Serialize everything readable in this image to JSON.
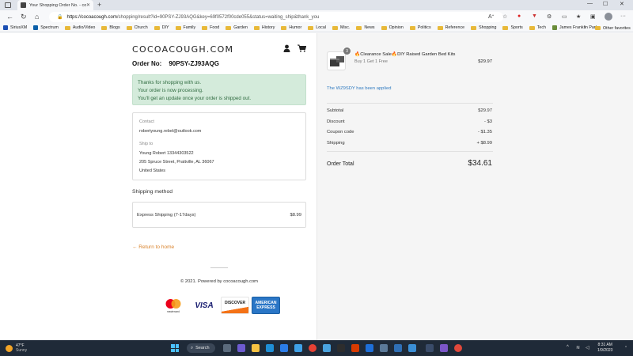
{
  "browser": {
    "tab_title": "Your Shopping Order No. - coco",
    "url_host": "https://cocoacough.com",
    "url_path": "/shopping/result?id=90PSY-ZJ93AQG&key=69f0572f00cde055&status=waiting_ship&thank_you",
    "bookmarks": [
      "SiriusXM",
      "Spectrum",
      "Audio/Video",
      "Blogs",
      "Church",
      "DIY",
      "Family",
      "Food",
      "Garden",
      "History",
      "Humor",
      "Local",
      "Misc.",
      "News",
      "Opinion",
      "Politics",
      "Reference",
      "Shopping",
      "Sports",
      "Tech",
      "James Franklin Park..."
    ],
    "other_favorites": "Other favorites"
  },
  "store": {
    "logo": "COCOACOUGH.COM",
    "order_label": "Order No:",
    "order_no": "90PSY-ZJ93AQG"
  },
  "notice": {
    "line1": "Thanks for shopping with us.",
    "line2": "Your order is now processing.",
    "line3": "You'll get an update once your order is shipped out."
  },
  "contact": {
    "label": "Contact",
    "email": "robertyoung.rebel@outlook.com",
    "ship_to_label": "Ship to",
    "name_phone": "Young Robert   13344303522",
    "address": "205 Spruce Street, Prattville, AL 36067",
    "country": "United States"
  },
  "shipping": {
    "title": "Shipping method",
    "method": "Express Shipping (7-17days)",
    "price": "$8.99"
  },
  "footer": {
    "return_link": "← Return to home",
    "powered": "© 2021. Powered by cocoacough.com",
    "cards": [
      "mastercard",
      "VISA",
      "DISCOVER",
      "AMERICAN EXPRESS"
    ]
  },
  "summary": {
    "qty": "3",
    "product_title": "🔥Clearance Sale🔥DIY Raised Garden Bed Kits",
    "product_variant": "Buy 1 Get 1 Free",
    "product_price": "$29.97",
    "applied_note": "The WZ9SDY has been applied",
    "subtotal_label": "Subtotal",
    "subtotal": "$29.97",
    "discount_label": "Discount",
    "discount": "- $3",
    "coupon_label": "Coupon code",
    "coupon": "- $1.35",
    "shipping_label": "Shipping",
    "shipping": "+ $8.99",
    "total_label": "Order Total",
    "total": "$34.61"
  },
  "taskbar": {
    "temp": "47°F",
    "condition": "Sunny",
    "search": "Search",
    "time": "8:31 AM",
    "date": "1/9/2023"
  }
}
